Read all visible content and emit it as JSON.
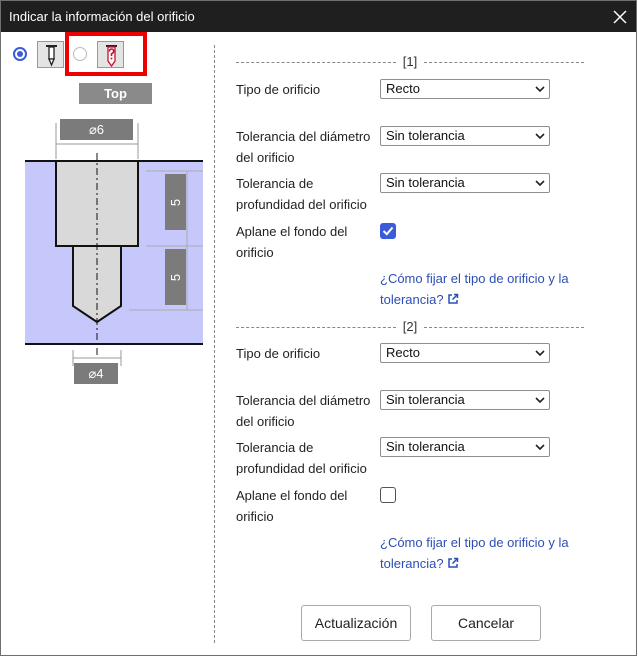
{
  "dialog": {
    "title": "Indicar la información del orificio"
  },
  "left": {
    "view_label": "Top",
    "dim_top": "⌀6",
    "dim_bottom": "⌀4",
    "dim_depth_upper": "5",
    "dim_depth_lower": "5"
  },
  "sections": [
    {
      "index_label": "[1]",
      "hole_type_label": "Tipo de orificio",
      "hole_type_value": "Recto",
      "diam_tol_label": [
        "Tolerancia del diámetro",
        "del orificio"
      ],
      "diam_tol_value": "Sin tolerancia",
      "depth_tol_label": [
        "Tolerancia de",
        "profundidad del orificio"
      ],
      "depth_tol_value": "Sin tolerancia",
      "flat_bottom_label": [
        "Aplane el fondo del",
        "orificio"
      ],
      "flat_bottom_checked": true,
      "help_link": [
        "¿Cómo fijar el tipo de orificio y la",
        "tolerancia?"
      ]
    },
    {
      "index_label": "[2]",
      "hole_type_label": "Tipo de orificio",
      "hole_type_value": "Recto",
      "diam_tol_label": [
        "Tolerancia del diámetro",
        "del orificio"
      ],
      "diam_tol_value": "Sin tolerancia",
      "depth_tol_label": [
        "Tolerancia de",
        "profundidad del orificio"
      ],
      "depth_tol_value": "Sin tolerancia",
      "flat_bottom_label": [
        "Aplane el fondo del",
        "orificio"
      ],
      "flat_bottom_checked": false,
      "help_link": [
        "¿Cómo fijar el tipo de orificio y la",
        "tolerancia?"
      ]
    }
  ],
  "buttons": {
    "update": "Actualización",
    "cancel": "Cancelar"
  },
  "colors": {
    "accent": "#3b5bdb",
    "link": "#2d4fb5",
    "highlight": "#ee0000",
    "titlebar": "#1f1f1f",
    "material": "#c6c8fb"
  },
  "icons": {
    "close": "close-icon",
    "external_link": "external-link-icon",
    "select_arrow": "chevron-down-icon"
  }
}
